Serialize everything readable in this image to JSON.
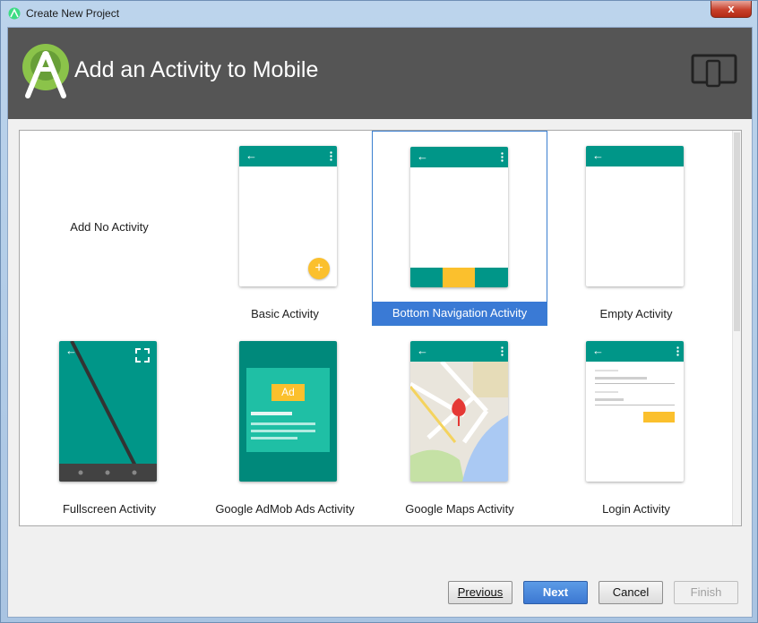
{
  "window": {
    "title": "Create New Project",
    "close_label": "x"
  },
  "header": {
    "title": "Add an Activity to Mobile"
  },
  "activities": [
    {
      "label": "Add No Activity"
    },
    {
      "label": "Basic Activity"
    },
    {
      "label": "Bottom Navigation Activity",
      "selected": true
    },
    {
      "label": "Empty Activity"
    },
    {
      "label": "Fullscreen Activity"
    },
    {
      "label": "Google AdMob Ads Activity"
    },
    {
      "label": "Google Maps Activity"
    },
    {
      "label": "Login Activity"
    }
  ],
  "preview": {
    "back_glyph": "←",
    "fab_glyph": "+",
    "ad_badge": "Ad"
  },
  "buttons": {
    "previous": "Previous",
    "next": "Next",
    "cancel": "Cancel",
    "finish": "Finish"
  },
  "colors": {
    "appbar": "#009688",
    "accent": "#FBC02D",
    "header": "#555555",
    "selection": "#3A7AD5"
  }
}
